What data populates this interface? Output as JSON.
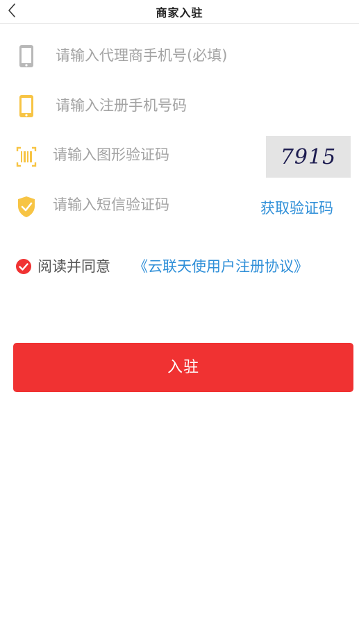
{
  "header": {
    "title": "商家入驻"
  },
  "form": {
    "agent_phone": {
      "placeholder": "请输入代理商手机号(必填)",
      "icon": "phone-gray-icon",
      "value": ""
    },
    "register_phone": {
      "placeholder": "请输入注册手机号码",
      "icon": "phone-yellow-icon",
      "value": ""
    },
    "image_code": {
      "placeholder": "请输入图形验证码",
      "icon": "barcode-scan-icon",
      "value": "",
      "captcha_text": "7915"
    },
    "sms_code": {
      "placeholder": "请输入短信验证码",
      "icon": "shield-check-icon",
      "value": "",
      "get_code_label": "获取验证码"
    }
  },
  "agreement": {
    "prefix": "阅读并同意",
    "link_text": "《云联天使用户注册协议》",
    "checked": true
  },
  "submit": {
    "label": "入驻"
  },
  "colors": {
    "accent_red": "#f03232",
    "link_blue": "#2f8fd8",
    "icon_yellow": "#f7c444",
    "icon_gray": "#b8b8b8",
    "placeholder_gray": "#a3a3a3"
  }
}
